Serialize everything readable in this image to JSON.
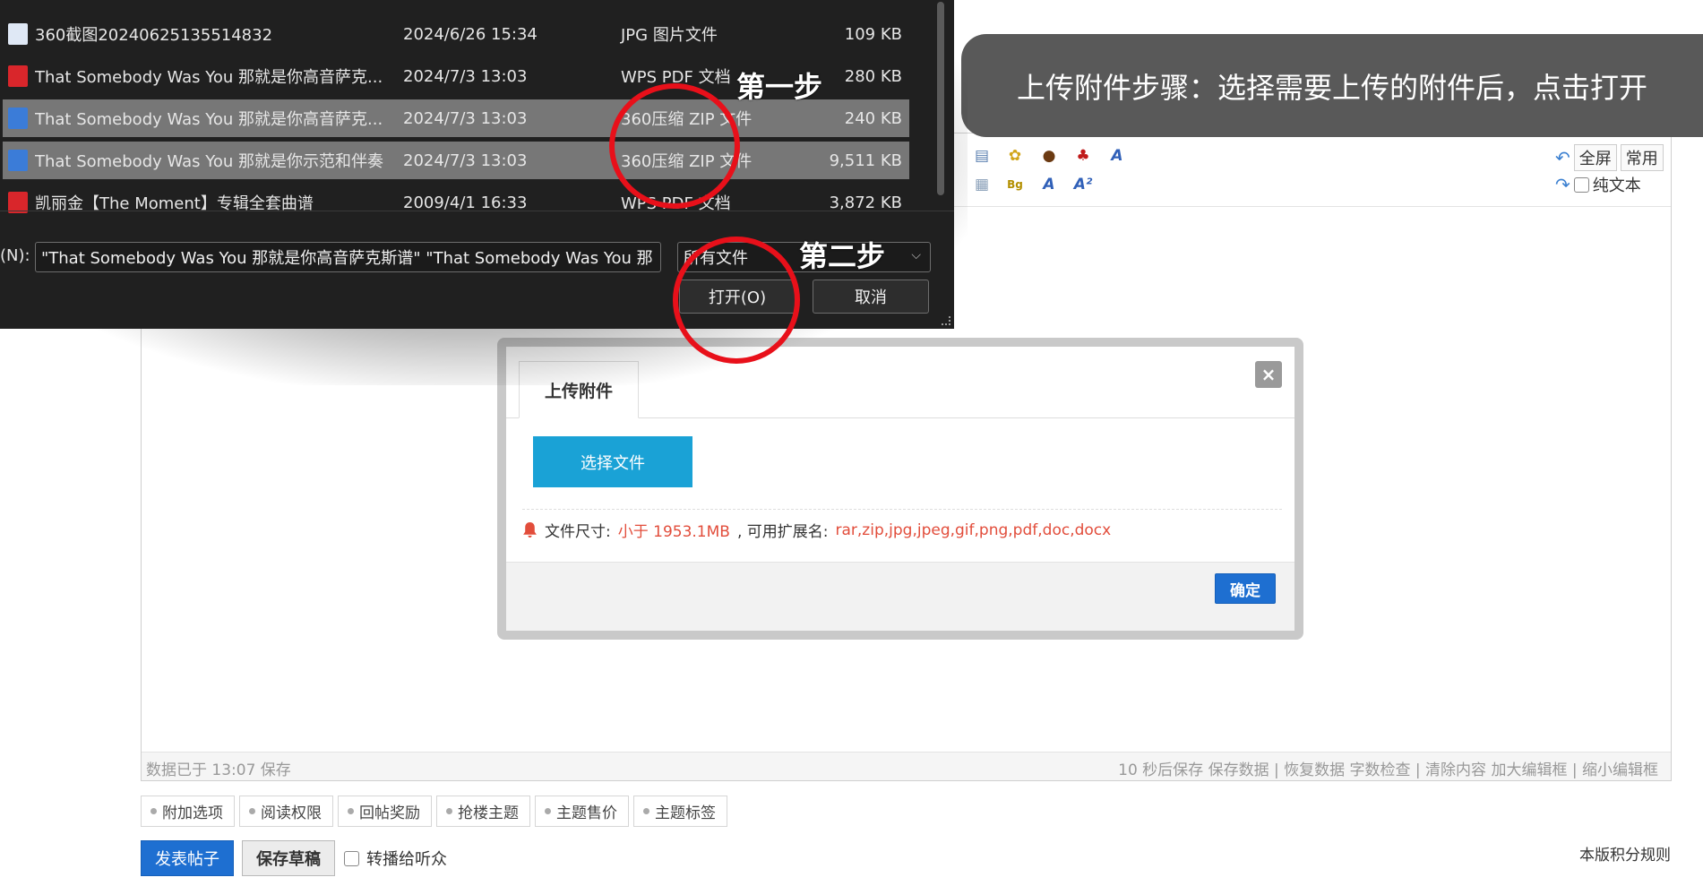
{
  "file_dialog": {
    "files": [
      {
        "name": "360截图20240625135514832",
        "date": "2024/6/26 15:34",
        "type": "JPG 图片文件",
        "size": "109 KB",
        "icon": "image-file-icon",
        "selected": false
      },
      {
        "name": "That Somebody Was You 那就是你高音萨克...",
        "date": "2024/7/3 13:03",
        "type": "WPS PDF 文档",
        "size": "280 KB",
        "icon": "pdf-file-icon",
        "selected": false
      },
      {
        "name": "That Somebody Was You 那就是你高音萨克...",
        "date": "2024/7/3 13:03",
        "type": "360压缩 ZIP 文件",
        "size": "240 KB",
        "icon": "zip-file-icon",
        "selected": true
      },
      {
        "name": "That Somebody Was You 那就是你示范和伴奏",
        "date": "2024/7/3 13:03",
        "type": "360压缩 ZIP 文件",
        "size": "9,511 KB",
        "icon": "zip-file-icon",
        "selected": true
      },
      {
        "name": "凯丽金【The Moment】专辑全套曲谱",
        "date": "2009/4/1 16:33",
        "type": "WPS PDF 文档",
        "size": "3,872 KB",
        "icon": "pdf-file-icon",
        "selected": false
      }
    ],
    "filename_label": "(N):",
    "filename_value": "\"That Somebody Was You 那就是你高音萨克斯谱\" \"That Somebody Was You 那",
    "filetype_value": "所有文件",
    "open_label": "打开(O)",
    "cancel_label": "取消"
  },
  "annotations": {
    "step1": "第一步",
    "step2": "第二步",
    "banner": "上传附件步骤：选择需要上传的附件后，点击打开"
  },
  "editor": {
    "toolbar_right": {
      "fullscreen": "全屏",
      "common": "常用",
      "plaintext": "纯文本"
    },
    "status_left": "数据已于 13:07 保存",
    "status_right": "10 秒后保存 保存数据 | 恢复数据    字数检查 | 清除内容    加大编辑框 | 缩小编辑框"
  },
  "upload_modal": {
    "tab": "上传附件",
    "close": "×",
    "select_file": "选择文件",
    "size_label": "文件尺寸:",
    "size_value": "小于 1953.1MB",
    "ext_label": ", 可用扩展名:",
    "ext_value": "rar,zip,jpg,jpeg,gif,png,pdf,doc,docx",
    "confirm": "确定"
  },
  "post_options": {
    "tabs": [
      "附加选项",
      "阅读权限",
      "回帖奖励",
      "抢楼主题",
      "主题售价",
      "主题标签"
    ],
    "publish": "发表帖子",
    "save_draft": "保存草稿",
    "broadcast": "转播给听众",
    "rules": "本版积分规则"
  },
  "colors": {
    "accent_blue": "#1e6fd1",
    "select_file_blue": "#1aa2d6",
    "hint_red": "#e24d3b",
    "annotation_red": "#e8101a",
    "dialog_bg": "#202020",
    "banner_bg": "#595959"
  }
}
